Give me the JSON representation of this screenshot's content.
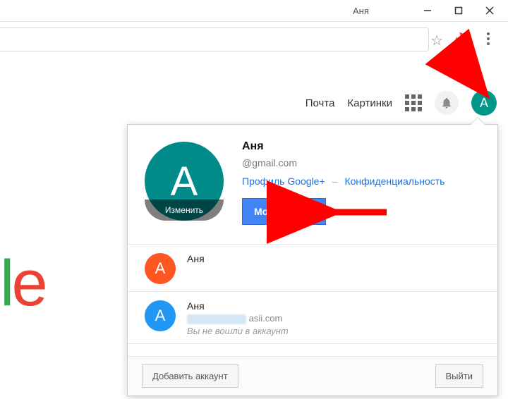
{
  "window": {
    "title": "Аня"
  },
  "page_links": {
    "mail": "Почта",
    "images": "Картинки"
  },
  "avatar_letter": "A",
  "popover": {
    "user_name": "Аня",
    "user_email": "@gmail.com",
    "google_plus_link": "Профиль Google+",
    "privacy_link": "Конфиденциальность",
    "my_account_btn": "Мой аккаунт",
    "edit_label": "Изменить",
    "accounts": [
      {
        "letter": "А",
        "name": "Аня",
        "email": "",
        "color": "orange"
      },
      {
        "letter": "А",
        "name": "Аня",
        "email": "asii.com",
        "note": "Вы не вошли в аккаунт",
        "color": "blue"
      }
    ],
    "add_account_btn": "Добавить аккаунт",
    "signout_btn": "Выйти"
  },
  "logo_fragment": {
    "l": "l",
    "e": "e"
  }
}
